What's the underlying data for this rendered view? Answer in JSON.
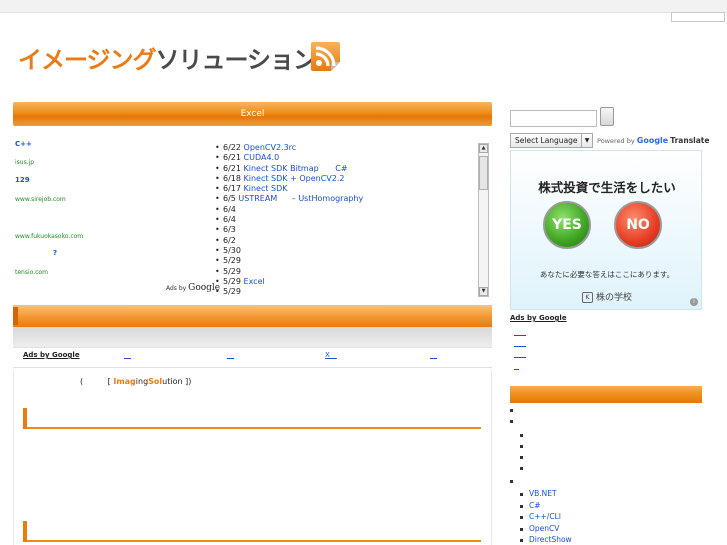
{
  "header": {
    "logo_part1": "イメージング",
    "logo_part2": "ソリューション",
    "rss_icon": "rss-feed-icon"
  },
  "left": {
    "excel_bar_title": "Excel",
    "ads": [
      {
        "text": "C++",
        "style": "blue"
      },
      {
        "text": "isus.jp",
        "style": "green"
      },
      {
        "text": "129",
        "style": "blue"
      },
      {
        "text": "www.sirejob.com",
        "style": "green"
      },
      {
        "text": "www.fukuokasoko.com",
        "style": "green"
      },
      {
        "text": "?",
        "style": "blue"
      },
      {
        "text": "tensio.com",
        "style": "green"
      }
    ],
    "ads_by_label": "Ads by",
    "ads_by_brand": "Google",
    "news": [
      {
        "date": "6/22",
        "link": "OpenCV2.3rc",
        "extra": ""
      },
      {
        "date": "6/21",
        "link": "CUDA4.0",
        "extra": ""
      },
      {
        "date": "6/21",
        "link": "Kinect SDK Bitmap",
        "extra": "C#"
      },
      {
        "date": "6/18",
        "link": "Kinect SDK + OpenCV2.2",
        "extra": ""
      },
      {
        "date": "6/17",
        "link": "Kinect SDK",
        "extra": ""
      },
      {
        "date": "6/5",
        "link": "USTREAM",
        "extra": "– UstHomography"
      },
      {
        "date": "6/4",
        "link": "",
        "extra": ""
      },
      {
        "date": "6/4",
        "link": "",
        "extra": ""
      },
      {
        "date": "6/3",
        "link": "",
        "extra": ""
      },
      {
        "date": "6/2",
        "link": "",
        "extra": ""
      },
      {
        "date": "5/30",
        "link": "",
        "extra": ""
      },
      {
        "date": "5/29",
        "link": "",
        "extra": ""
      },
      {
        "date": "5/29",
        "link": "",
        "extra": ""
      },
      {
        "date": "5/29",
        "link": "Excel",
        "extra": ""
      },
      {
        "date": "5/29",
        "link": "",
        "extra": ""
      }
    ],
    "adlinks_title": "Ads by Google",
    "adlinks": [
      "__",
      "__",
      "X__",
      "__"
    ],
    "imaging_paren": "(",
    "imaging_open": "[",
    "imaging_hi1": "Imag",
    "imaging_mid": "ing",
    "imaging_hi2": "Sol",
    "imaging_end": "ution ])"
  },
  "right": {
    "lang_select_value": "Select Language",
    "powered_by": "Powered by",
    "powered_google": "Google",
    "powered_translate": "Translate",
    "banner_title": "株式投資で生活をしたい",
    "banner_yes": "YES",
    "banner_no": "NO",
    "banner_sub": "あなたに必要な答えはここにあります。",
    "banner_school": "株の学校",
    "ads_by_google": "Ads by Google",
    "categories": [
      "VB.NET",
      "C#",
      "C++/CLI",
      "OpenCV",
      "DirectShow"
    ]
  }
}
